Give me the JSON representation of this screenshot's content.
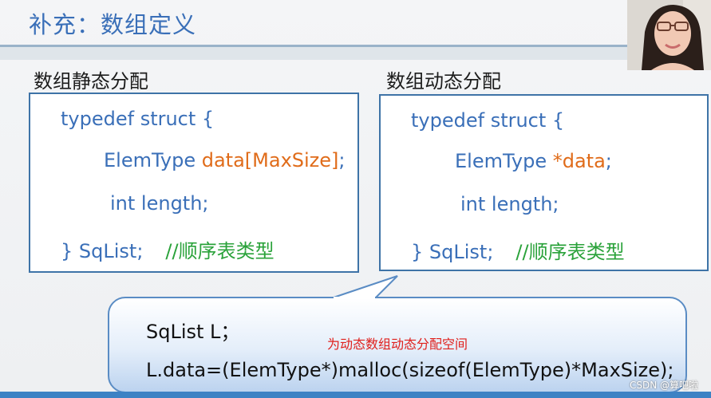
{
  "slide": {
    "title": "补充：数组定义"
  },
  "static_section": {
    "heading": "数组静态分配",
    "line1": "typedef struct {",
    "line2_type": "ElemType ",
    "line2_member": "data[MaxSize]",
    "line2_end": ";",
    "line3": "int length;",
    "line4": "} SqList;",
    "line4_comment": "//顺序表类型"
  },
  "dynamic_section": {
    "heading": "数组动态分配",
    "line1": "typedef struct {",
    "line2_type": "ElemType ",
    "line2_member": "*data",
    "line2_end": ";",
    "line3": "int length;",
    "line4": "} SqList;",
    "line4_comment": "//顺序表类型"
  },
  "callout": {
    "line1": "SqList L；",
    "annotation": "为动态数组动态分配空间",
    "line2": "L.data=(ElemType*)malloc(sizeof(ElemType)*MaxSize);"
  },
  "watermark": "CSDN @算吧啦",
  "colors": {
    "code_blue": "#3a6fb8",
    "highlight_orange": "#e06c1a",
    "comment_green": "#2aa23a",
    "annotation_red": "#e0201c",
    "box_border": "#3e73a7"
  }
}
